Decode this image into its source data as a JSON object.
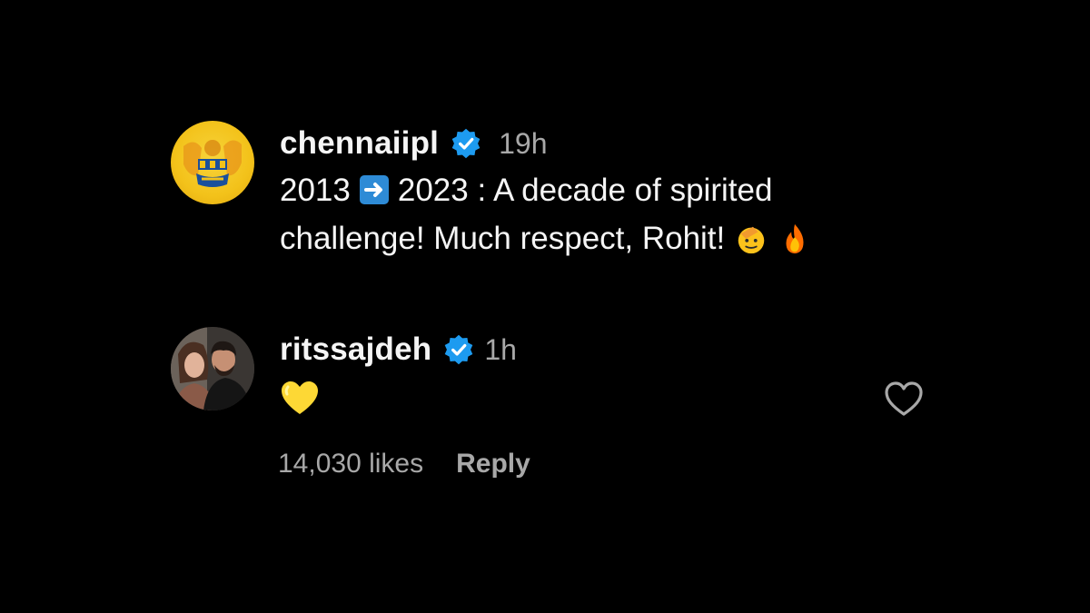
{
  "comments": [
    {
      "username": "chennaiipl",
      "verified": true,
      "time": "19h",
      "text_parts": [
        "2013",
        "2023 : A decade of spirited challenge! Much respect, Rohit!"
      ],
      "inline_emojis": [
        "arrow-right-emoji",
        "saluting-face-emoji",
        "fire-emoji"
      ]
    },
    {
      "username": "ritssajdeh",
      "verified": true,
      "time": "1h",
      "emoji": "yellow-heart-emoji",
      "like_icon": "heart-outline-icon"
    }
  ],
  "actions": {
    "likes": "14,030 likes",
    "reply": "Reply"
  },
  "colors": {
    "background": "#000000",
    "text": "#f5f5f5",
    "secondary": "#a8a8a8",
    "verified": "#1d9bf0"
  }
}
